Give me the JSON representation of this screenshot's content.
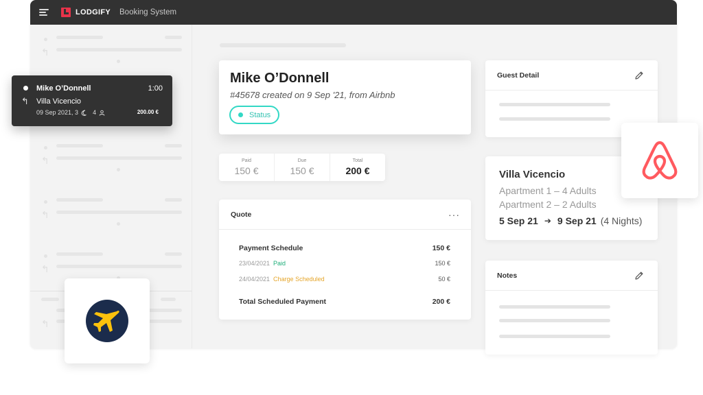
{
  "topbar": {
    "brand": "LODGIFY",
    "app_name": "Booking System",
    "brand_color": "#e8334a"
  },
  "tooltip": {
    "name": "Mike O’Donnell",
    "time": "1:00",
    "villa": "Villa Vicencio",
    "date": "09 Sep 2021, 3",
    "guests": "4",
    "price": "200.00 €"
  },
  "booking": {
    "guest_name": "Mike O’Donnell",
    "subtitle": "#45678 created on 9 Sep '21, from Airbnb",
    "status_label": "Status",
    "status_color": "#32d8c5"
  },
  "payments": [
    {
      "label": "Paid",
      "value": "150 €"
    },
    {
      "label": "Due",
      "value": "150 €"
    },
    {
      "label": "Total",
      "value": "200 €"
    }
  ],
  "quote": {
    "title": "Quote",
    "more": "···",
    "schedule_label": "Payment Schedule",
    "schedule_value": "150 €",
    "rows": [
      {
        "date": "23/04/2021",
        "status": "Paid",
        "amount": "150 €"
      },
      {
        "date": "24/04/2021",
        "status": "Charge Scheduled",
        "amount": "50 €"
      }
    ],
    "total_label": "Total Scheduled Payment",
    "total_value": "200 €"
  },
  "guest_detail": {
    "title": "Guest Detail"
  },
  "property": {
    "name": "Villa Vicencio",
    "apartments": [
      "Apartment 1 – 4 Adults",
      "Apartment 2 – 2 Adults"
    ],
    "check_in": "5 Sep 21",
    "check_out": "9 Sep 21",
    "nights": "(4 Nights)"
  },
  "notes": {
    "title": "Notes"
  },
  "icons": {
    "airbnb": "airbnb-logo",
    "expedia": "expedia-logo",
    "edit": "pencil-icon",
    "moon": "moon-icon",
    "person": "person-icon",
    "back_arrow": "reply-arrow-icon"
  },
  "colors": {
    "airbnb": "#ff5a5f",
    "expedia_bg": "#1b2c4c",
    "expedia_plane": "#fbc10c",
    "paid": "#1fae7a",
    "scheduled": "#e5a52a"
  }
}
